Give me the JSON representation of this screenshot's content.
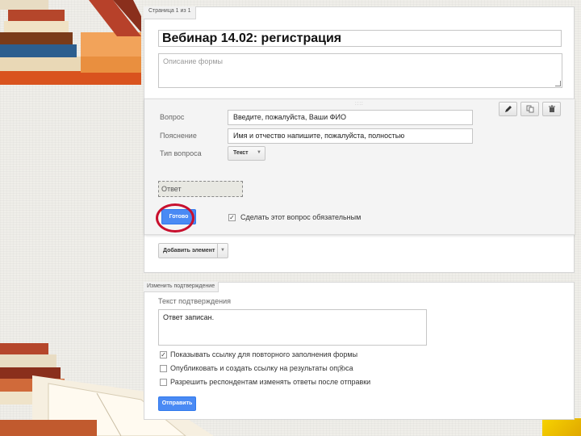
{
  "form": {
    "page_indicator": "Страница 1 из 1",
    "title": "Вебинар  14.02: регистрация",
    "description_placeholder": "Описание формы"
  },
  "question": {
    "drag_handle": "::::",
    "toolbar": {
      "edit_icon": "pencil-icon",
      "copy_icon": "copy-icon",
      "delete_icon": "trash-icon"
    },
    "labels": {
      "question": "Вопрос",
      "hint": "Пояснение",
      "type": "Тип вопроса"
    },
    "question_value": "Введите, пожалуйста, Ваши ФИО",
    "hint_value": "Имя и отчество напишите, пожалуйста, полностью",
    "type_value": "Текст",
    "answer_placeholder": "Ответ",
    "done_label": "Готово",
    "required_label": "Сделать этот вопрос обязательным",
    "required_checked": true
  },
  "add_element_label": "Добавить элемент",
  "confirmation": {
    "tab_label": "Изменить подтверждение",
    "heading": "Текст подтверждения",
    "text": "Ответ записан.",
    "options": [
      {
        "label": "Показывать ссылку для повторного заполнения формы",
        "checked": true
      },
      {
        "label": "Опубликовать и создать ссылку на результаты опроса",
        "checked": false,
        "help": "?"
      },
      {
        "label": "Разрешить респондентам изменять ответы после отправки",
        "checked": false
      }
    ],
    "send_label": "Отправить"
  },
  "colors": {
    "primary_button": "#4a8af4",
    "highlight_circle": "#c8102e",
    "corner_accent": "#f7d300"
  }
}
